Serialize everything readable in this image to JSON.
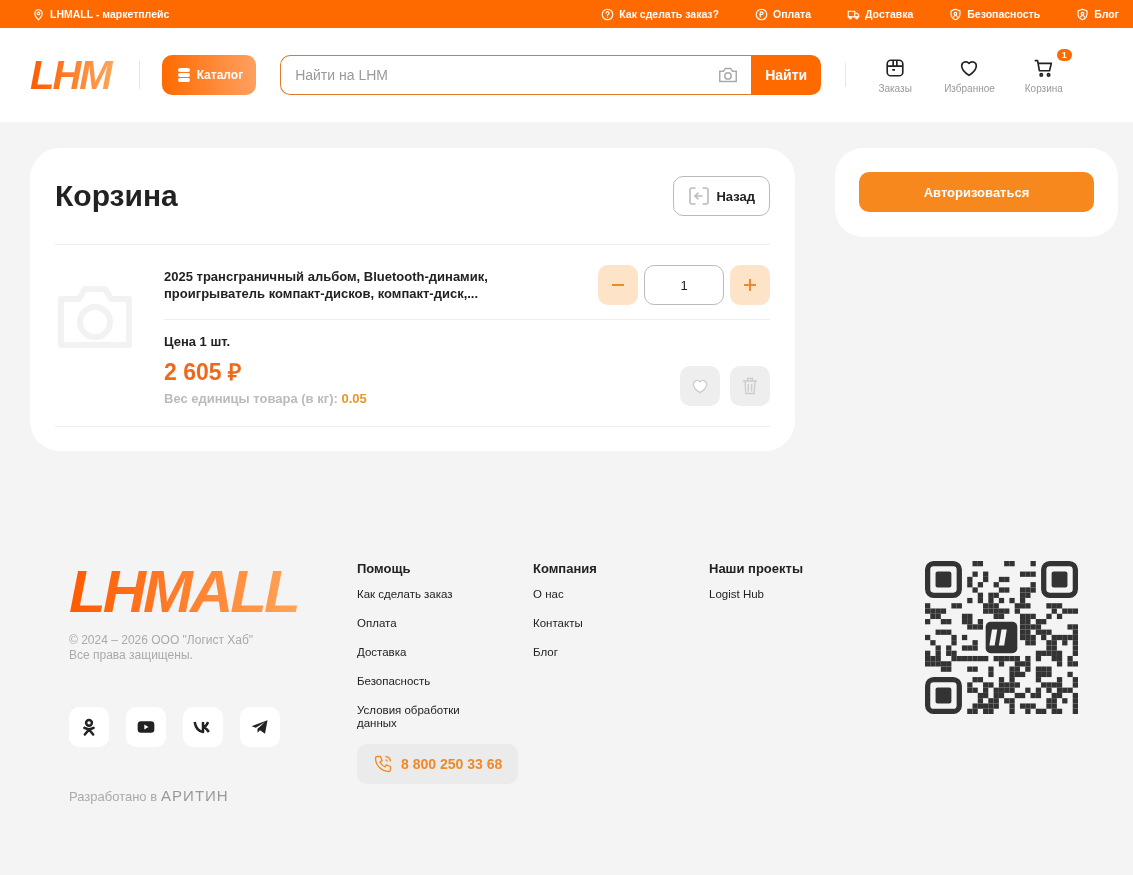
{
  "topbar": {
    "brand": "LHMALL - маркетплейс",
    "links": [
      {
        "label": "Как сделать заказ?",
        "kind": "help"
      },
      {
        "label": "Оплата",
        "kind": "pay"
      },
      {
        "label": "Доставка",
        "kind": "delivery"
      },
      {
        "label": "Безопасность",
        "kind": "security"
      },
      {
        "label": "Блог",
        "kind": "blog"
      }
    ]
  },
  "header": {
    "logo": "LHM",
    "catalog": "Каталог",
    "search": {
      "placeholder": "Найти на LHM",
      "button": "Найти"
    },
    "actions": [
      {
        "label": "Заказы",
        "kind": "orders"
      },
      {
        "label": "Избранное",
        "kind": "favorites"
      },
      {
        "label": "Корзина",
        "kind": "cart",
        "badge": "1"
      }
    ]
  },
  "cart": {
    "title": "Корзина",
    "back": "Назад",
    "items": [
      {
        "name": "2025 трансграничный альбом, Bluetooth-динамик, проигрыватель компакт-дисков, компакт-диск,...",
        "quantity": "1",
        "price_label": "Цена 1 шт.",
        "price": "2 605 ₽",
        "weight_label": "Вес единицы товара (в кг):",
        "weight": "0.05"
      }
    ]
  },
  "auth": {
    "button": "Авторизоваться"
  },
  "footer": {
    "logo": "LHMALL",
    "copyright": [
      "© 2024 – 2026 ООО \"Логист Хаб\"",
      "Все права защищены."
    ],
    "socials": [
      {
        "kind": "ok"
      },
      {
        "kind": "youtube"
      },
      {
        "kind": "vk"
      },
      {
        "kind": "telegram"
      }
    ],
    "developed": "Разработано в",
    "developer": "АРИТИН",
    "columns": [
      {
        "title": "Помощь",
        "links": [
          "Как сделать заказ",
          "Оплата",
          "Доставка",
          "Безопасность",
          "Условия обработки данных"
        ]
      },
      {
        "title": "Компания",
        "links": [
          "О нас",
          "Контакты",
          "Блог"
        ]
      },
      {
        "title": "Наши проекты",
        "links": [
          "Logist Hub"
        ]
      }
    ],
    "phone": "8 800 250 33 68"
  }
}
